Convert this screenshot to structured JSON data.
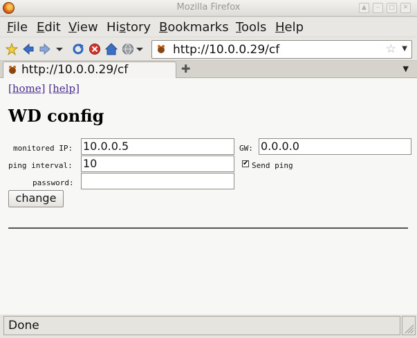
{
  "window": {
    "title": "Mozilla Firefox"
  },
  "menubar": {
    "file": "File",
    "edit": "Edit",
    "view": "View",
    "history": "History",
    "bookmarks": "Bookmarks",
    "tools": "Tools",
    "help": "Help"
  },
  "toolbar": {
    "url": "http://10.0.0.29/cf"
  },
  "tabs": [
    {
      "label": "http://10.0.0.29/cf"
    }
  ],
  "page": {
    "links": {
      "home": "[home]",
      "help": "[help]"
    },
    "title": "WD config",
    "form": {
      "monitored_ip_label": "monitored IP:",
      "monitored_ip_value": "10.0.0.5",
      "gw_label": "GW:",
      "gw_value": "0.0.0.0",
      "ping_interval_label": "ping interval:",
      "ping_interval_value": "10",
      "send_ping_label": "Send ping",
      "send_ping_checked": true,
      "password_label": "password:",
      "password_value": "",
      "submit_label": "change"
    }
  },
  "status": {
    "text": "Done"
  },
  "colors": {
    "link": "#4a2a8c",
    "page_bg": "#f7f7f5",
    "chrome_bg": "#e9e7e3"
  }
}
